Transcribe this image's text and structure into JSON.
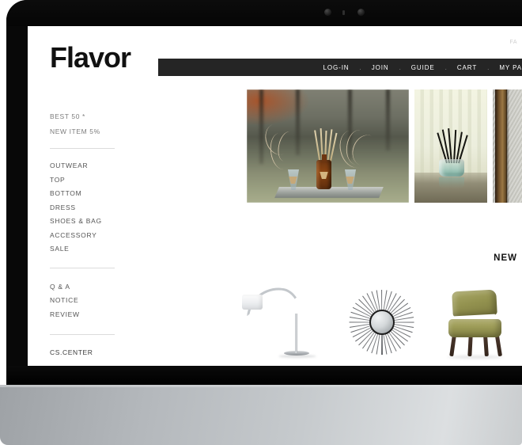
{
  "device": {
    "type": "desktop-monitor",
    "bezel_color": "#080808",
    "stand_color": "#c6cacd"
  },
  "site": {
    "logo": "Flavor",
    "utility_text": "FA",
    "accent_dark": "#252525",
    "text_gray": "#7d7d7d"
  },
  "nav": {
    "separator": ".",
    "items": [
      {
        "label": "LOG-IN"
      },
      {
        "label": "JOIN"
      },
      {
        "label": "GUIDE"
      },
      {
        "label": "CART"
      },
      {
        "label": "MY PA"
      }
    ]
  },
  "sidebar": {
    "promos": [
      {
        "label": "BEST 50 *"
      },
      {
        "label": "NEW ITEM 5%"
      }
    ],
    "categories": [
      {
        "label": "OUTWEAR"
      },
      {
        "label": "TOP"
      },
      {
        "label": "BOTTOM"
      },
      {
        "label": "DRESS"
      },
      {
        "label": "SHOES & BAG"
      },
      {
        "label": "ACCESSORY"
      },
      {
        "label": "SALE"
      }
    ],
    "support": [
      {
        "label": "Q & A"
      },
      {
        "label": "NOTICE"
      },
      {
        "label": "REVIEW"
      }
    ],
    "cs_center": "CS.CENTER"
  },
  "hero": {
    "slides": [
      {
        "name": "reed-diffusers-outdoors"
      },
      {
        "name": "glass-diffuser-black-reeds"
      },
      {
        "name": "wood-frame-wall"
      }
    ]
  },
  "sections": {
    "new_heading": "NEW"
  },
  "products": [
    {
      "name": "arc-floor-lamp"
    },
    {
      "name": "sunburst-mirror"
    },
    {
      "name": "olive-accent-chair"
    }
  ]
}
